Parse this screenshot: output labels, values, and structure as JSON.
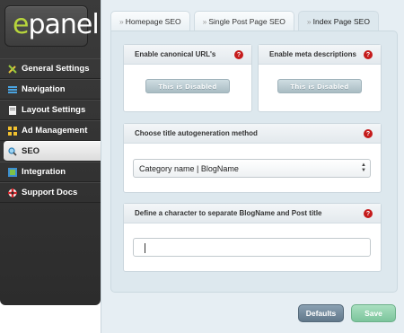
{
  "logo": {
    "e": "e",
    "rest": "panel"
  },
  "nav": [
    {
      "label": "General Settings"
    },
    {
      "label": "Navigation"
    },
    {
      "label": "Layout Settings"
    },
    {
      "label": "Ad Management"
    },
    {
      "label": "SEO"
    },
    {
      "label": "Integration"
    },
    {
      "label": "Support Docs"
    }
  ],
  "tabs": [
    {
      "arrow": "»",
      "label": "Homepage SEO"
    },
    {
      "arrow": "»",
      "label": "Single Post Page SEO"
    },
    {
      "arrow": "»",
      "label": "Index Page SEO"
    }
  ],
  "boxes": {
    "canonical": {
      "title": "Enable canonical URL's",
      "toggle": "This is Disabled",
      "help": "?"
    },
    "meta": {
      "title": "Enable meta descriptions",
      "toggle": "This is Disabled",
      "help": "?"
    },
    "title_method": {
      "title": "Choose title autogeneration method",
      "value": "Category name | BlogName",
      "help": "?"
    },
    "separator": {
      "title": "Define a character to separate BlogName and Post title",
      "value": "",
      "help": "?"
    }
  },
  "buttons": {
    "defaults": "Defaults",
    "save": "Save"
  }
}
